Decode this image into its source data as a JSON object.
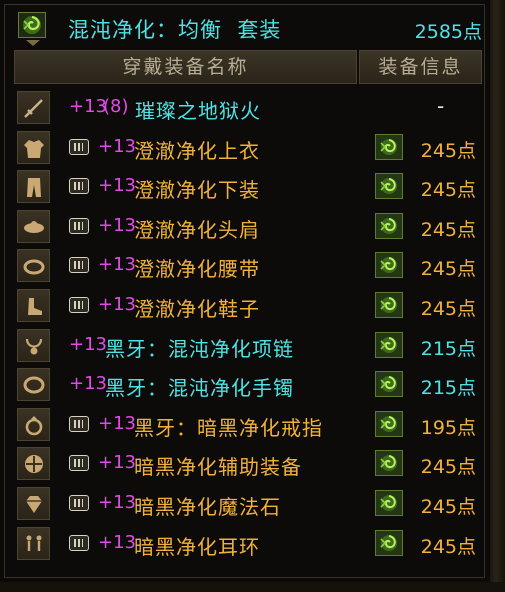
{
  "header": {
    "title": "混沌净化：均衡  套装",
    "total_points": "2585点",
    "icon": "green-swirl-gem-icon"
  },
  "columns": {
    "name": "穿戴装备名称",
    "info": "装备信息"
  },
  "colors": {
    "cyan": "#4fe2e4",
    "gold": "#f2b23a",
    "magenta": "#e24ae6",
    "header_text": "#b8ad92"
  },
  "items": [
    {
      "slot_icon": "weapon-icon",
      "badge": false,
      "enhance": "+13",
      "extra": "(8)",
      "name": "璀璨之地狱火",
      "name_color": "cyan",
      "points": "-",
      "gem": false
    },
    {
      "slot_icon": "top-armor-icon",
      "badge": true,
      "enhance": "+13",
      "extra": "",
      "name": "澄澈净化上衣",
      "name_color": "gold",
      "points": "245点",
      "gem": true,
      "points_color": "gold"
    },
    {
      "slot_icon": "pants-icon",
      "badge": true,
      "enhance": "+13",
      "extra": "",
      "name": "澄澈净化下装",
      "name_color": "gold",
      "points": "245点",
      "gem": true,
      "points_color": "gold"
    },
    {
      "slot_icon": "shoulder-icon",
      "badge": true,
      "enhance": "+13",
      "extra": "",
      "name": "澄澈净化头肩",
      "name_color": "gold",
      "points": "245点",
      "gem": true,
      "points_color": "gold"
    },
    {
      "slot_icon": "belt-icon",
      "badge": true,
      "enhance": "+13",
      "extra": "",
      "name": "澄澈净化腰带",
      "name_color": "gold",
      "points": "245点",
      "gem": true,
      "points_color": "gold"
    },
    {
      "slot_icon": "shoes-icon",
      "badge": true,
      "enhance": "+13",
      "extra": "",
      "name": "澄澈净化鞋子",
      "name_color": "gold",
      "points": "245点",
      "gem": true,
      "points_color": "gold"
    },
    {
      "slot_icon": "necklace-icon",
      "badge": false,
      "enhance": "+13",
      "extra": "",
      "name": "黑牙：混沌净化项链",
      "name_color": "cyan",
      "points": "215点",
      "gem": true,
      "points_color": "cyan"
    },
    {
      "slot_icon": "bracelet-icon",
      "badge": false,
      "enhance": "+13",
      "extra": "",
      "name": "黑牙：混沌净化手镯",
      "name_color": "cyan",
      "points": "215点",
      "gem": true,
      "points_color": "cyan"
    },
    {
      "slot_icon": "ring-icon",
      "badge": true,
      "enhance": "+13",
      "extra": "",
      "name": "黑牙：暗黑净化戒指",
      "name_color": "gold",
      "points": "195点",
      "gem": true,
      "points_color": "gold"
    },
    {
      "slot_icon": "support-equipment-icon",
      "badge": true,
      "enhance": "+13",
      "extra": "",
      "name": "暗黑净化辅助装备",
      "name_color": "gold",
      "points": "245点",
      "gem": true,
      "points_color": "gold"
    },
    {
      "slot_icon": "magic-stone-icon",
      "badge": true,
      "enhance": "+13",
      "extra": "",
      "name": "暗黑净化魔法石",
      "name_color": "gold",
      "points": "245点",
      "gem": true,
      "points_color": "gold"
    },
    {
      "slot_icon": "earring-icon",
      "badge": true,
      "enhance": "+13",
      "extra": "",
      "name": "暗黑净化耳环",
      "name_color": "gold",
      "points": "245点",
      "gem": true,
      "points_color": "gold"
    }
  ]
}
